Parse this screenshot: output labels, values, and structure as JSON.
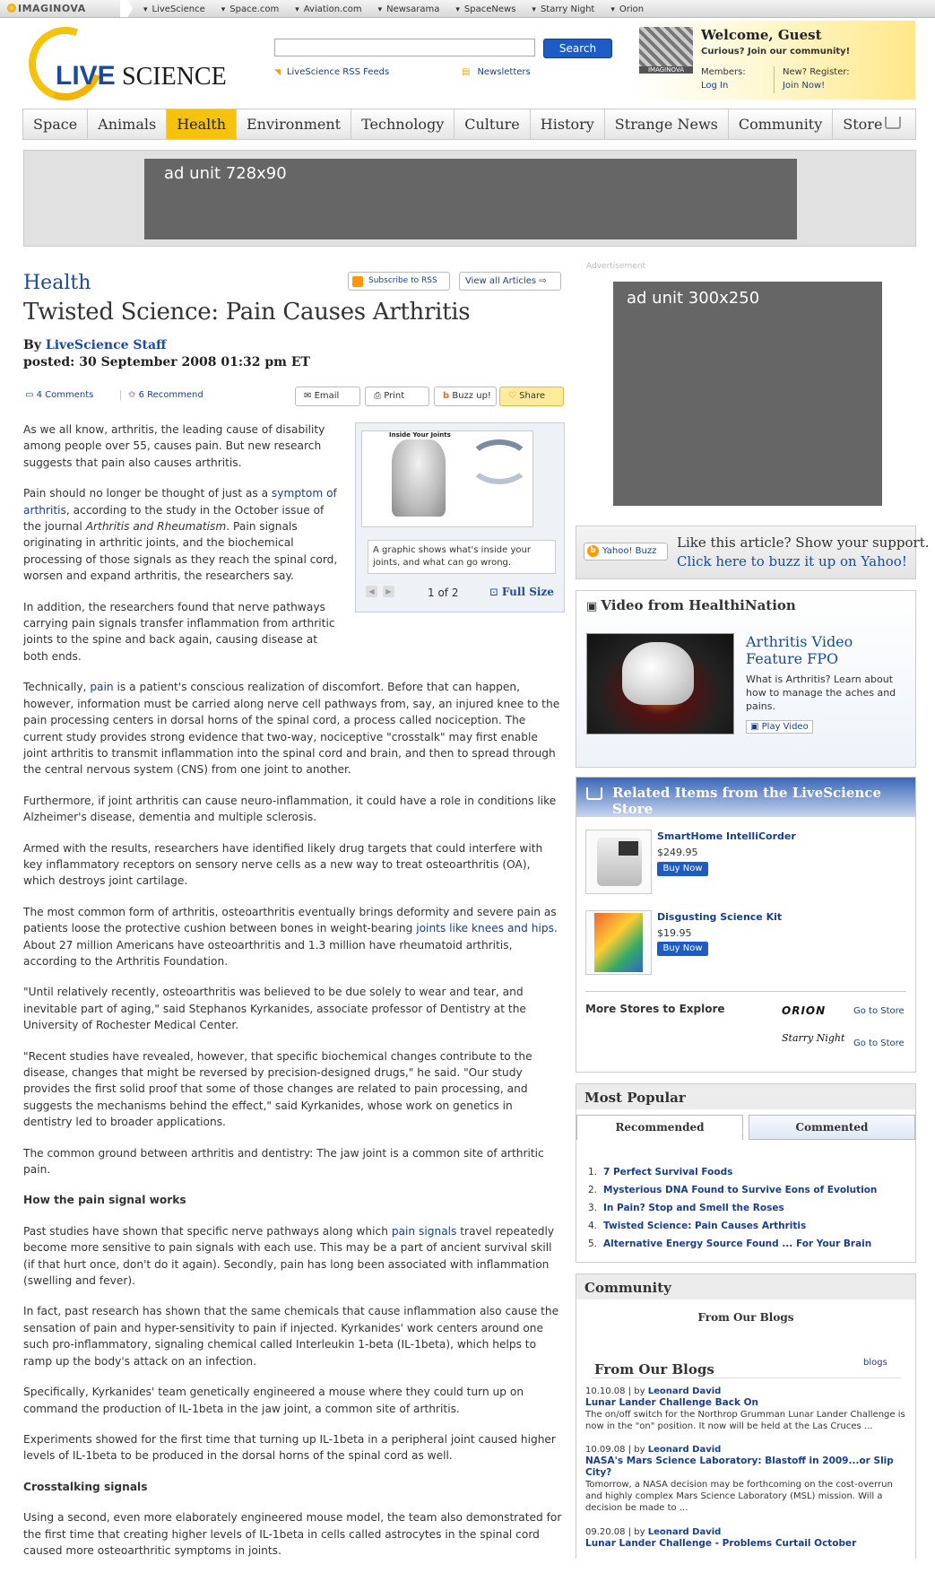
{
  "network_bar": {
    "brand": "IMAGINOVA",
    "sites": [
      "LiveScience",
      "Space.com",
      "Aviation.com",
      "Newsarama",
      "SpaceNews",
      "Starry Night",
      "Orion"
    ]
  },
  "header": {
    "logo_live": "LIVE",
    "logo_science": "SCIENCE",
    "search_button": "Search",
    "search_value": "",
    "rss_link": "LiveScience RSS Feeds",
    "newsletters_link": "Newsletters",
    "badge": "IMAGINOVA",
    "welcome_title": "Welcome, Guest",
    "welcome_sub": "Curious? Join our community!",
    "members_label": "Members:",
    "login_link": "Log In",
    "register_label": "New? Register:",
    "join_link": "Join Now!"
  },
  "nav": {
    "items": [
      "Space",
      "Animals",
      "Health",
      "Environment",
      "Technology",
      "Culture",
      "History",
      "Strange News",
      "Community",
      "Store"
    ],
    "active": "Health"
  },
  "ads": {
    "leaderboard": "ad unit 728x90",
    "sidebar_label": "Advertisement",
    "sidebar": "ad unit 300x250"
  },
  "article": {
    "section": "Health",
    "subscribe": "Subscribe to RSS",
    "view_all": "View all Articles",
    "headline": "Twisted Science: Pain Causes Arthritis",
    "by": "By ",
    "author": "LiveScience Staff",
    "posted": "posted: 30 September 2008 01:32 pm ET",
    "comments": "4 Comments",
    "recommend": "6 Recommend",
    "tools": {
      "email": "Email",
      "print": "Print",
      "buzz": "Buzz up!",
      "share": "Share"
    },
    "figure": {
      "img_title": "Inside Your Joints",
      "caption": "A graphic shows what's inside your joints, and what can go wrong.",
      "count": "1 of 2",
      "full_size": "Full Size"
    },
    "p1": "As we all know, arthritis, the leading cause of disability among people over 55, causes pain. But new research suggests that pain also causes arthritis.",
    "p2_a": "Pain should no longer be thought of just as a ",
    "p2_link": "symptom of arthritis",
    "p2_b": ", according to the study in the October issue of the journal ",
    "p2_journal": "Arthritis and Rheumatism",
    "p2_c": ". Pain signals originating in arthritic joints, and the biochemical processing of those signals as they reach the spinal cord, worsen and expand arthritis, the researchers say.",
    "p3": "In addition, the researchers found that nerve pathways carrying pain signals transfer inflammation from arthritic joints to the spine and back again, causing disease at both ends.",
    "p4_a": "Technically, ",
    "p4_link": "pain",
    "p4_b": " is a patient's conscious realization of discomfort. Before that can happen, however, information must be carried along nerve cell pathways from, say, an injured knee to the pain processing centers in dorsal horns of the spinal cord, a process called nociception. The current study provides strong evidence that two-way, nociceptive \"crosstalk\" may first enable joint arthritis to transmit inflammation into the spinal cord and brain, and then to spread through the central nervous system (CNS) from one joint to another.",
    "p5": "Furthermore, if joint arthritis can cause neuro-inflammation, it could have a role in conditions like Alzheimer's disease, dementia and multiple sclerosis.",
    "p6": "Armed with the results, researchers have identified likely drug targets that could interfere with key inflammatory receptors on sensory nerve cells as a new way to treat osteoarthritis (OA), which destroys joint cartilage.",
    "p7_a": "The most common form of arthritis, osteoarthritis eventually brings deformity and severe pain as patients loose the protective cushion between bones in weight-bearing ",
    "p7_link": "joints like knees and hips",
    "p7_b": ". About 27 million Americans have osteoarthritis and 1.3 million have rheumatoid arthritis, according to the Arthritis Foundation.",
    "p8": "\"Until relatively recently, osteoarthritis was believed to be due solely to wear and tear, and inevitable part of aging,\" said Stephanos Kyrkanides, associate professor of Dentistry at the University of Rochester Medical Center.",
    "p9": "\"Recent studies have revealed, however, that specific biochemical changes contribute to the disease, changes that might be reversed by precision-designed drugs,\" he said. \"Our study provides the first solid proof that some of those changes are related to pain processing, and suggests the mechanisms behind the effect,\" said Kyrkanides, whose work on genetics in dentistry led to broader applications.",
    "p10": "The common ground between arthritis and dentistry: The jaw joint is a common site of arthritic pain.",
    "h1": "How the pain signal works",
    "p11_a": "Past studies have shown that specific nerve pathways along which ",
    "p11_link": "pain signals",
    "p11_b": " travel repeatedly become more sensitive to pain signals with each use. This may be a part of ancient survival skill (if that hurt once, don't do it again). Secondly, pain has long been associated with inflammation (swelling and fever).",
    "p12": "In fact, past research has shown that the same chemicals that cause inflammation also cause the sensation of pain and hyper-sensitivity to pain if injected. Kyrkanides' work centers around one such pro-inflammatory, signaling chemical called Interleukin 1-beta (IL-1beta), which helps to ramp up the body's attack on an infection.",
    "p13": "Specifically, Kyrkanides' team genetically engineered a mouse where they could turn up on command the production of IL-1beta in the jaw joint, a common site of arthritis.",
    "p14": "Experiments showed for the first time that turning up IL-1beta in a peripheral joint caused higher levels of IL-1beta to be produced in the dorsal horns of the spinal cord as well.",
    "h2": "Crosstalking signals",
    "p15": "Using a second, even more elaborately engineered mouse model, the team also demonstrated for the first time that creating higher levels of IL-1beta in cells called astrocytes in the spinal cord caused more osteoarthritic symptoms in joints."
  },
  "sidebar": {
    "buzz_button": "Yahoo! Buzz",
    "buzz_line1": "Like this article? Show your support.",
    "buzz_line2": "Click here to buzz it up on Yahoo!",
    "video_head": "Video from HealthiNation",
    "video_title": "Arthritis Video Feature FPO",
    "video_desc": "What is Arthritis? Learn about how to manage the aches and pains.",
    "play_video": "Play Video",
    "store_head": "Related Items from the LiveScience Store",
    "products": [
      {
        "name": "SmartHome IntelliCorder",
        "price": "$249.95",
        "buy": "Buy Now"
      },
      {
        "name": "Disgusting Science Kit",
        "price": "$19.95",
        "buy": "Buy Now"
      }
    ],
    "more_stores": "More Stores to Explore",
    "orion": "ORION",
    "starry": "Starry Night",
    "go_to_store": "Go to Store",
    "popular_head": "Most Popular",
    "tab_recommended": "Recommended",
    "tab_commented": "Commented",
    "popular": [
      "7 Perfect Survival Foods",
      "Mysterious DNA Found to Survive Eons of Evolution",
      "In Pain? Stop and Smell the Roses",
      "Twisted Science: Pain Causes Arthritis",
      "Alternative Energy Source Found ... For Your Brain"
    ],
    "community_head": "Community",
    "community_sub": "From Our Blogs",
    "blogs_head": "From Our Blogs",
    "blogs_tab": "blogs",
    "blog_entries": [
      {
        "date": "10.10.08",
        "by": "| by ",
        "author": "Leonard David",
        "title": "Lunar Lander Challenge Back On",
        "excerpt": "The on/off switch for the Northrop Grumman Lunar Lander Challenge is now in the \"on\" position. It now will be held at the Las Cruces ..."
      },
      {
        "date": "10.09.08",
        "by": "| by ",
        "author": "Leonard David",
        "title": "NASA's Mars Science Laboratory: Blastoff in 2009...or Slip City?",
        "excerpt": "Tomorrow, a NASA decision may be forthcoming on the cost-overrun and highly complex Mars Science Laboratory (MSL) mission. Will a decision be made to ..."
      },
      {
        "date": "09.20.08",
        "by": "| by ",
        "author": "Leonard David",
        "title": "Lunar Lander Challenge - Problems Curtail October",
        "excerpt": ""
      }
    ]
  }
}
